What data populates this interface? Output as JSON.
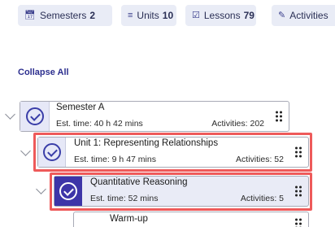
{
  "tabs": [
    {
      "icon": "calendar-icon",
      "label": "Semesters",
      "count": "2"
    },
    {
      "icon": "layers-icon",
      "label": "Units",
      "count": "10"
    },
    {
      "icon": "checklist-icon",
      "label": "Lessons",
      "count": "79"
    },
    {
      "icon": "edit-document-icon",
      "label": "Activities",
      "count": ""
    }
  ],
  "collapse_all": "Collapse All",
  "tree": {
    "semester": {
      "title": "Semester A",
      "est": "Est. time: 40 h 42 mins",
      "activities": "Activities: 202"
    },
    "unit": {
      "title": "Unit 1: Representing Relationships",
      "est": "Est. time: 9 h 47 mins",
      "activities": "Activities: 52"
    },
    "lesson": {
      "title": "Quantitative Reasoning",
      "est": "Est. time: 52 mins",
      "activities": "Activities: 5"
    },
    "activity": {
      "title": "Warm-up"
    }
  },
  "colors": {
    "accent": "#3d35a8",
    "highlight": "#ee5a5a",
    "tab_bg": "#e9ecf6"
  }
}
